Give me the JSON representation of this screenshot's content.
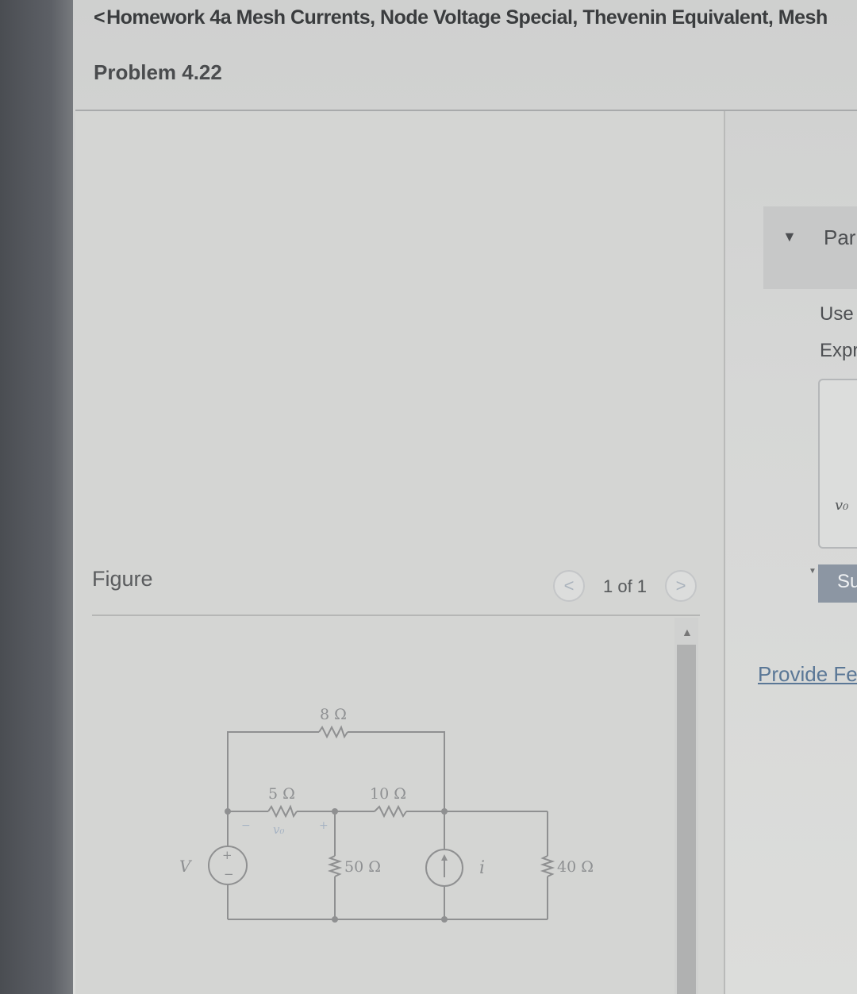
{
  "header": {
    "back_glyph": "<",
    "assignment_title": "Homework 4a Mesh Currents, Node Voltage Special, Thevenin Equivalent, Mesh",
    "problem_title": "Problem 4.22"
  },
  "figure_panel": {
    "label": "Figure",
    "page_indicator": "1 of 1",
    "prev_glyph": "<",
    "next_glyph": ">"
  },
  "circuit": {
    "resistors": [
      {
        "id": "r8",
        "label": "8 Ω"
      },
      {
        "id": "r5",
        "label": "5 Ω"
      },
      {
        "id": "r10",
        "label": "10 Ω"
      },
      {
        "id": "r50",
        "label": "50 Ω"
      },
      {
        "id": "r40",
        "label": "40 Ω"
      }
    ],
    "voltage_source_label": "V",
    "current_source_label": "i",
    "output_voltage_label": "v₀",
    "plus_sign": "+",
    "minus_sign": "−"
  },
  "answer_panel": {
    "part_label": "Par",
    "instruction_line1": "Use",
    "instruction_line2": "Expr",
    "answer_variable": "v₀",
    "submit_label": "Su",
    "feedback_link": "Provide Fe"
  },
  "colors": {
    "link": "#5a7796",
    "submit_bg": "#8c96a3",
    "wire": "#8f9091"
  }
}
